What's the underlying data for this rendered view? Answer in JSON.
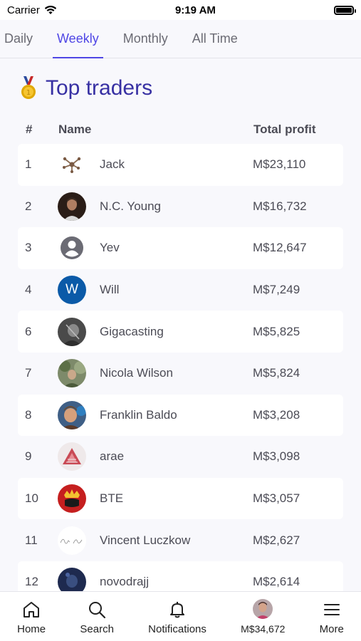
{
  "status": {
    "carrier": "Carrier",
    "time": "9:19 AM"
  },
  "tabs": [
    {
      "label": "Daily",
      "active": false
    },
    {
      "label": "Weekly",
      "active": true
    },
    {
      "label": "Monthly",
      "active": false
    },
    {
      "label": "All Time",
      "active": false
    }
  ],
  "heading": {
    "title": "Top traders",
    "icon": "medal-icon"
  },
  "table": {
    "headers": {
      "rank": "#",
      "name": "Name",
      "profit": "Total profit"
    },
    "rows": [
      {
        "rank": "1",
        "name": "Jack",
        "profit": "M$23,110",
        "avatar": "network-logo"
      },
      {
        "rank": "2",
        "name": "N.C. Young",
        "profit": "M$16,732",
        "avatar": "photo-dark-man"
      },
      {
        "rank": "3",
        "name": "Yev",
        "profit": "M$12,647",
        "avatar": "default-user-icon"
      },
      {
        "rank": "4",
        "name": "Will",
        "profit": "M$7,249",
        "avatar": "letter-w"
      },
      {
        "rank": "6",
        "name": "Gigacasting",
        "profit": "M$5,825",
        "avatar": "photo-gray"
      },
      {
        "rank": "7",
        "name": "Nicola Wilson",
        "profit": "M$5,824",
        "avatar": "photo-outdoor"
      },
      {
        "rank": "8",
        "name": "Franklin Baldo",
        "profit": "M$3,208",
        "avatar": "photo-man"
      },
      {
        "rank": "9",
        "name": "arae",
        "profit": "M$3,098",
        "avatar": "red-pyramid"
      },
      {
        "rank": "10",
        "name": "BTE",
        "profit": "M$3,057",
        "avatar": "red-crown"
      },
      {
        "rank": "11",
        "name": "Vincent Luczkow",
        "profit": "M$2,627",
        "avatar": "signature"
      },
      {
        "rank": "12",
        "name": "novodrajj",
        "profit": "M$2,614",
        "avatar": "photo-dark-blue"
      }
    ]
  },
  "avatar_letter_w": "W",
  "nav": [
    {
      "label": "Home",
      "icon": "home-icon"
    },
    {
      "label": "Search",
      "icon": "search-icon"
    },
    {
      "label": "Notifications",
      "icon": "bell-icon"
    },
    {
      "label": "M$34,672",
      "icon": "user-avatar"
    },
    {
      "label": "More",
      "icon": "menu-icon"
    }
  ],
  "colors": {
    "accent": "#4f46e5",
    "heading": "#3730a3",
    "background": "#f8f8fc"
  }
}
